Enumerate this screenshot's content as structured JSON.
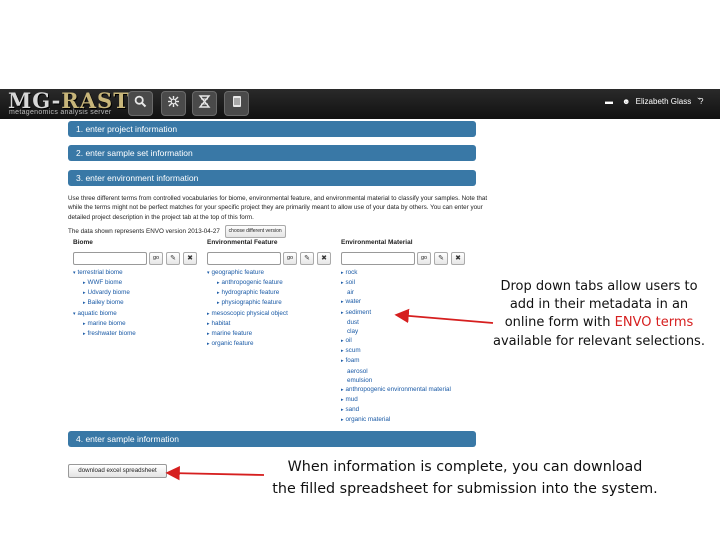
{
  "navbar": {
    "logo_main": "MG-",
    "logo_accent": "RAST",
    "logo_sub": "metagenomics analysis server",
    "buttons": [
      {
        "icon": "search-icon",
        "glyph": "🔍"
      },
      {
        "icon": "cog-icon",
        "glyph": "✱"
      },
      {
        "icon": "dna-icon",
        "glyph": "⧗"
      },
      {
        "icon": "notebook-icon",
        "glyph": "❙"
      }
    ],
    "folder_glyph": "▬",
    "user_glyph": "☻",
    "user_name": "Elizabeth Glass",
    "user_caret": "ˇ",
    "help": "?"
  },
  "sections": {
    "s1": "1. enter project information",
    "s2": "2. enter sample set information",
    "s3": "3. enter environment information",
    "s4": "4. enter sample information"
  },
  "description": "Use three different terms from controlled vocabularies for biome, environmental feature, and environmental material to classify your samples. Note that while the terms might not be perfect matches for your specific project they are primarily meant to allow use of your data by others. You can enter your detailed project description in the project tab at the top of this form.",
  "version": {
    "text": "The data shown represents ENVO version 2013-04-27",
    "button": "choose different version"
  },
  "columns": {
    "biome": {
      "title": "Biome",
      "go": "go",
      "items": [
        {
          "label": "terrestrial biome",
          "expanded": true,
          "level": 0
        },
        {
          "label": "WWF biome",
          "expanded": false,
          "level": 1
        },
        {
          "label": "Udvardy biome",
          "expanded": false,
          "level": 1
        },
        {
          "label": "Bailey biome",
          "expanded": false,
          "level": 1
        },
        {
          "label": "aquatic biome",
          "expanded": true,
          "level": 0
        },
        {
          "label": "marine biome",
          "expanded": false,
          "level": 1
        },
        {
          "label": "freshwater biome",
          "expanded": false,
          "level": 1
        }
      ]
    },
    "feature": {
      "title": "Environmental Feature",
      "go": "go",
      "items": [
        {
          "label": "geographic feature",
          "expanded": true,
          "level": 0
        },
        {
          "label": "anthropogenic feature",
          "expanded": false,
          "level": 1
        },
        {
          "label": "hydrographic feature",
          "expanded": false,
          "level": 1
        },
        {
          "label": "physiographic feature",
          "expanded": false,
          "level": 1
        },
        {
          "label": "mesoscopic physical object",
          "expanded": false,
          "level": 0
        },
        {
          "label": "habitat",
          "expanded": false,
          "level": 0
        },
        {
          "label": "marine feature",
          "expanded": false,
          "level": 0
        },
        {
          "label": "organic feature",
          "expanded": false,
          "level": 0
        }
      ]
    },
    "material": {
      "title": "Environmental Material",
      "go": "go",
      "items": [
        {
          "label": "rock",
          "expanded": false,
          "level": 0
        },
        {
          "label": "soil",
          "expanded": false,
          "level": 0
        },
        {
          "label": "air",
          "leaf": true,
          "level": 0
        },
        {
          "label": "water",
          "expanded": false,
          "level": 0
        },
        {
          "label": "sediment",
          "expanded": false,
          "level": 0
        },
        {
          "label": "dust",
          "leaf": true,
          "level": 0
        },
        {
          "label": "clay",
          "leaf": true,
          "level": 0
        },
        {
          "label": "oil",
          "expanded": false,
          "level": 0
        },
        {
          "label": "scum",
          "expanded": false,
          "level": 0
        },
        {
          "label": "foam",
          "expanded": false,
          "level": 0
        },
        {
          "label": "aerosol",
          "leaf": true,
          "level": 0
        },
        {
          "label": "emulsion",
          "leaf": true,
          "level": 0
        },
        {
          "label": "anthropogenic environmental material",
          "expanded": false,
          "level": 0
        },
        {
          "label": "mud",
          "expanded": false,
          "level": 0
        },
        {
          "label": "sand",
          "expanded": false,
          "level": 0
        },
        {
          "label": "organic material",
          "expanded": false,
          "level": 0
        }
      ]
    }
  },
  "download_button": "download excel spreadsheet",
  "callouts": {
    "dropdown_pre": "Drop down tabs allow users to add in their metadata in an online form with ",
    "dropdown_red": "ENVO terms",
    "dropdown_post": " available for relevant selections.",
    "download_line1": "When information is complete, you can download",
    "download_line2": "the filled spreadsheet for submission into the system."
  },
  "colors": {
    "section_bar": "#3978a6",
    "link": "#1a5aa6",
    "highlight_red": "#d61f1f",
    "navbar": "#1a1a1a"
  }
}
